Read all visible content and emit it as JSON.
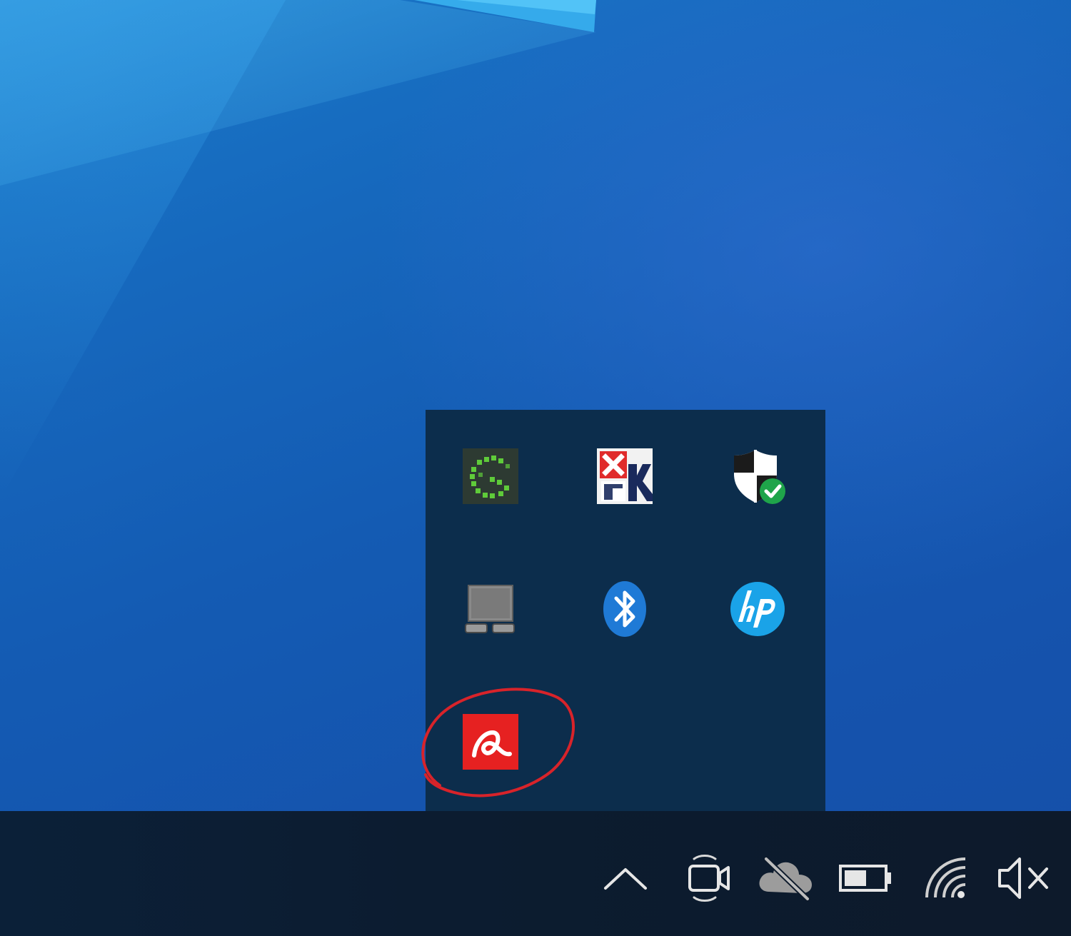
{
  "desktop": {
    "wallpaper": "windows-10-blue-light-rays",
    "accent_color": "#1668bd"
  },
  "tray_overflow": {
    "background_color": "#0c2d4c",
    "icons": [
      {
        "name": "greenshot-icon",
        "color": "#5fcb3a"
      },
      {
        "name": "kaspersky-style-red-x-icon",
        "color": "#e02b2b"
      },
      {
        "name": "windows-security-shield-icon",
        "color": "#1fa44a"
      },
      {
        "name": "device-removal-icon",
        "color": "#8a8a8a"
      },
      {
        "name": "bluetooth-icon",
        "color": "#1f7ad6"
      },
      {
        "name": "hp-icon",
        "color": "#1aa3e8"
      },
      {
        "name": "avira-icon",
        "color": "#e62121"
      }
    ]
  },
  "annotation": {
    "shape": "hand-drawn-ellipse",
    "color": "#d8232a",
    "highlights": "avira-icon"
  },
  "taskbar": {
    "background_color": "#0d1c2e",
    "system_icons": [
      {
        "name": "show-hidden-icons-chevron-up-icon"
      },
      {
        "name": "meet-now-camera-icon"
      },
      {
        "name": "onedrive-offline-cloud-icon"
      },
      {
        "name": "battery-icon"
      },
      {
        "name": "wifi-icon"
      },
      {
        "name": "speaker-muted-icon"
      }
    ]
  }
}
